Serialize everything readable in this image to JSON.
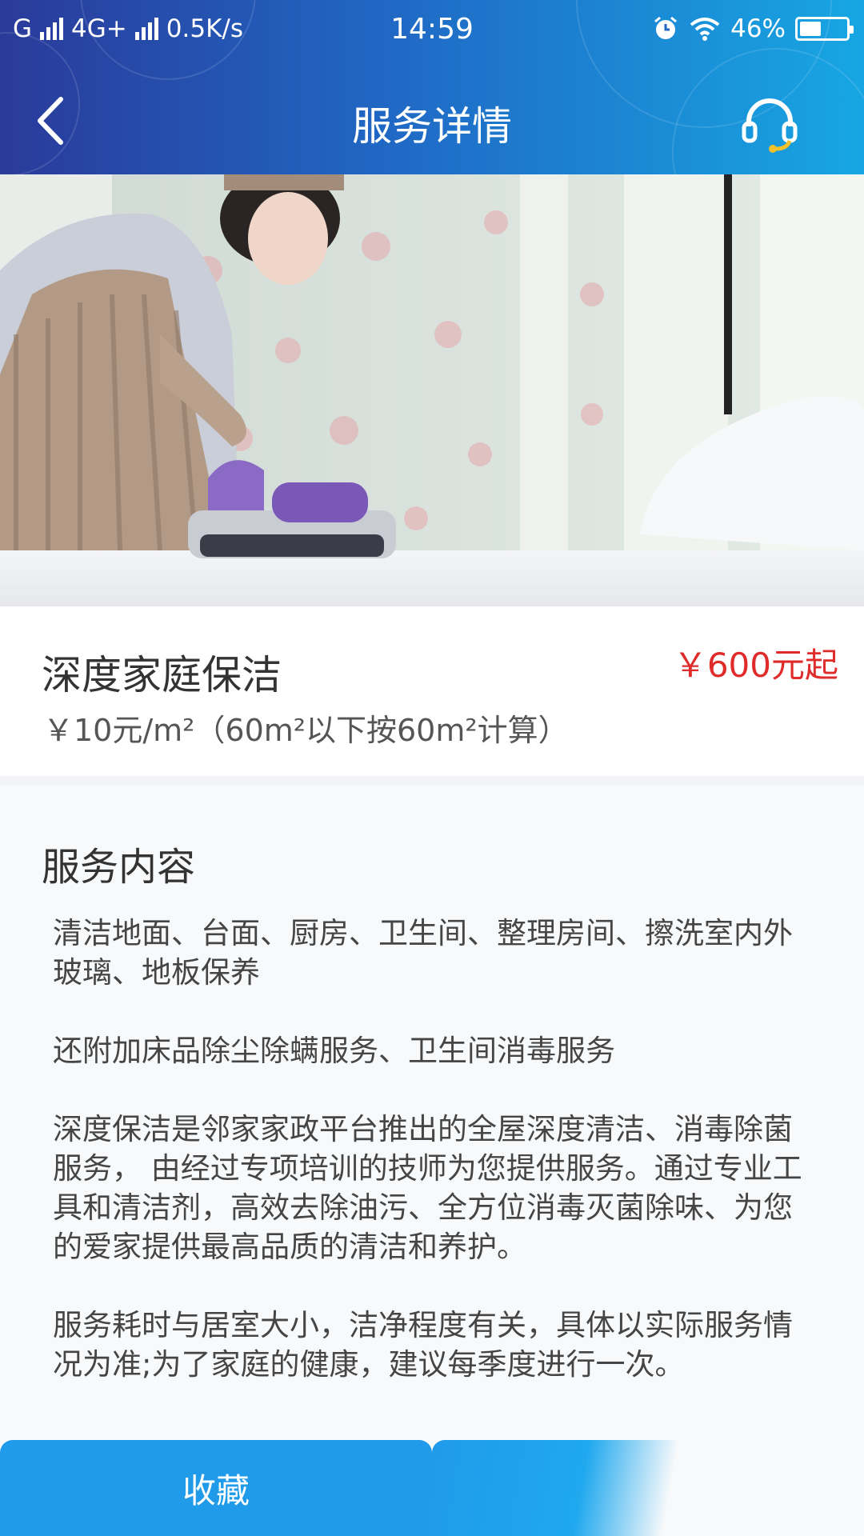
{
  "status_bar": {
    "carrier": "G",
    "network": "4G+",
    "speed": "0.5K/s",
    "time": "14:59",
    "battery": "46%",
    "battery_level": 0.46
  },
  "nav": {
    "title": "服务详情",
    "back_icon": "chevron-left-icon",
    "support_icon": "headset-icon"
  },
  "service": {
    "title": "深度家庭保洁",
    "price": "￥600元起",
    "unit_price": "￥10元/m²（60m²以下按60m²计算）"
  },
  "content": {
    "section_title": "服务内容",
    "paragraphs": [
      "清洁地面、台面、厨房、卫生间、整理房间、擦洗室内外玻璃、地板保养",
      "还附加床品除尘除螨服务、卫生间消毒服务",
      "深度保洁是邻家家政平台推出的全屋深度清洁、消毒除菌服务， 由经过专项培训的技师为您提供服务。通过专业工具和清洁剂，高效去除油污、全方位消毒灭菌除味、为您的爱家提供最高品质的清洁和养护。",
      "服务耗时与居室大小，洁净程度有关，具体以实际服务情况为准;为了家庭的健康，建议每季度进行一次。"
    ]
  },
  "bottom": {
    "favorite_label": "收藏"
  },
  "colors": {
    "header_start": "#2a3a9a",
    "header_end": "#17a6e3",
    "price_red": "#e02b2b",
    "button_blue": "#1f9be9",
    "headset_accent": "#f2c12e"
  }
}
